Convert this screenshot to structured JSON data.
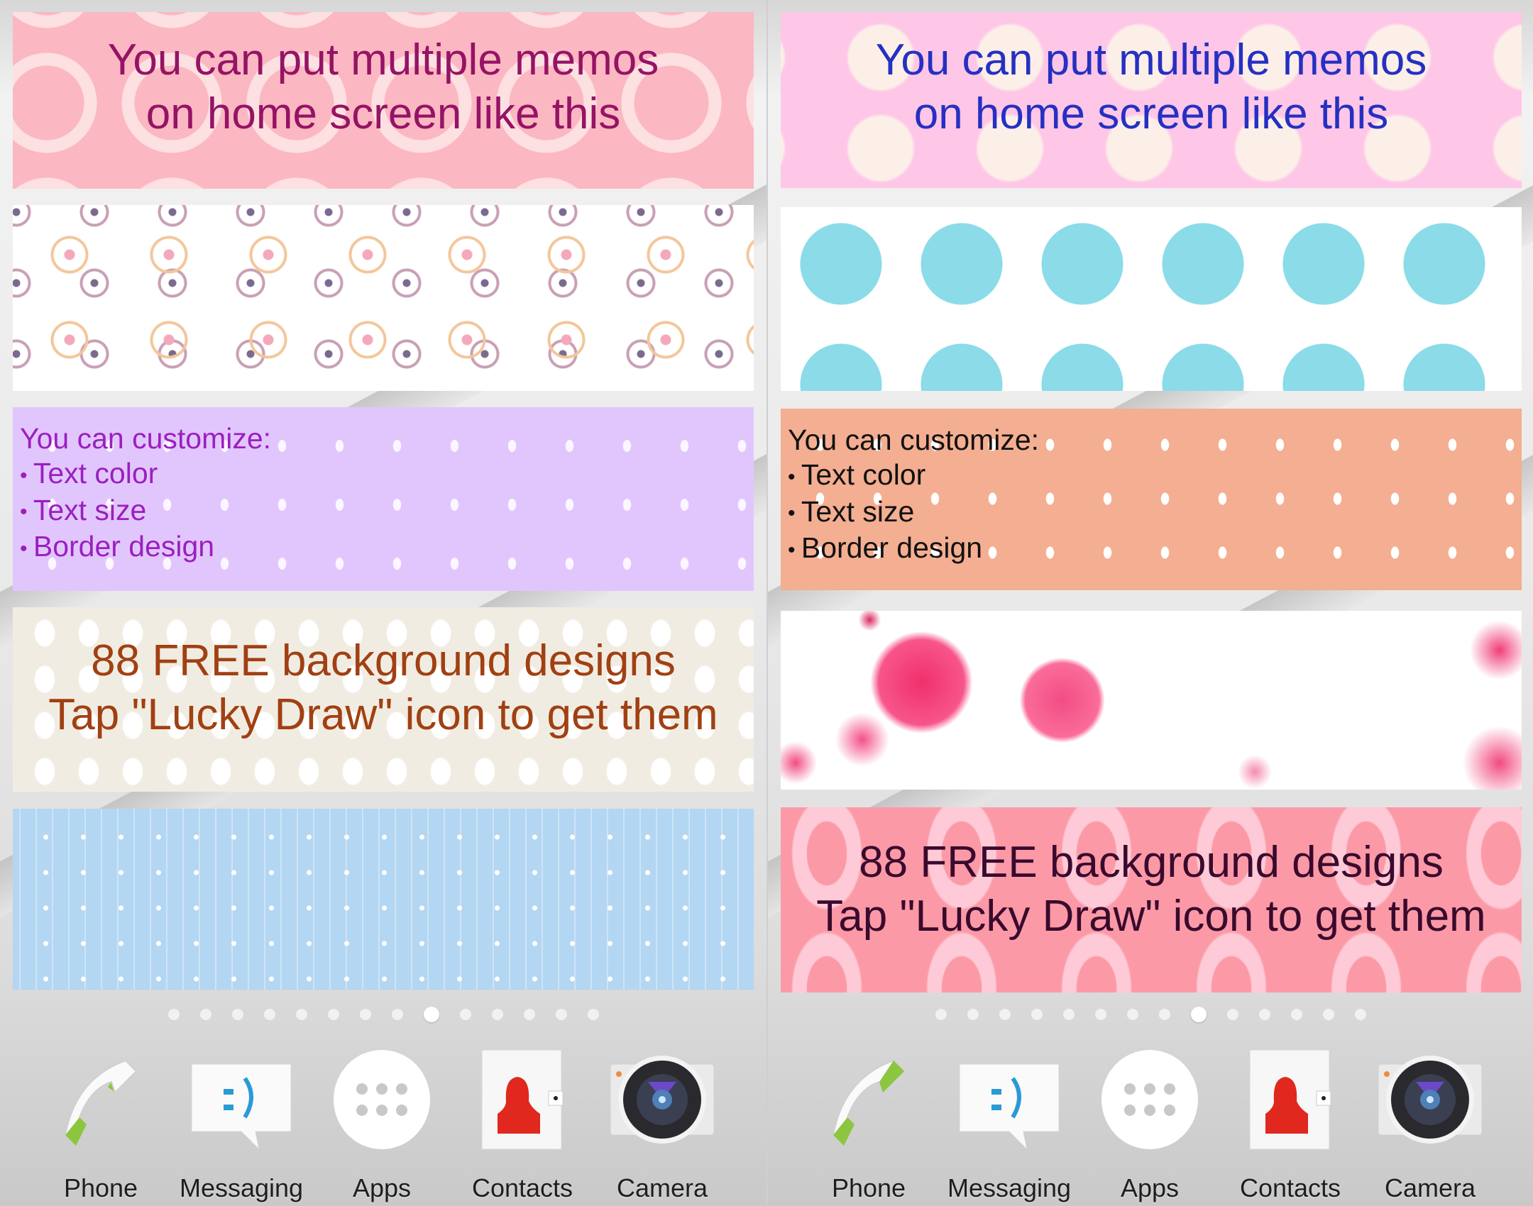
{
  "screens": [
    {
      "side": "left",
      "memos": [
        {
          "lines": [
            "You can put multiple memos",
            "on home screen like this"
          ],
          "text_color": "#951365",
          "style": "pink-rings"
        },
        {
          "lines": [],
          "style": "white-circles"
        },
        {
          "heading": "You can customize:",
          "items": [
            "Text color",
            "Text size",
            "Border design"
          ],
          "text_color": "#9b1fbf",
          "style": "lilac-dots"
        },
        {
          "lines": [
            "88 FREE background designs",
            "Tap \"Lucky Draw\" icon to get them"
          ],
          "text_color": "#a14012",
          "style": "cream-scallop"
        },
        {
          "lines": [],
          "style": "blue-flowers"
        }
      ],
      "pager": {
        "count": 14,
        "active_index": 8
      },
      "dock": [
        {
          "label": "Phone",
          "icon": "phone-icon"
        },
        {
          "label": "Messaging",
          "icon": "messaging-icon"
        },
        {
          "label": "Apps",
          "icon": "apps-icon"
        },
        {
          "label": "Contacts",
          "icon": "contacts-icon"
        },
        {
          "label": "Camera",
          "icon": "camera-icon"
        }
      ]
    },
    {
      "side": "right",
      "memos": [
        {
          "lines": [
            "You can put multiple memos",
            "on home screen like this"
          ],
          "text_color": "#2530c2",
          "style": "pink-fluff"
        },
        {
          "lines": [],
          "style": "cyan-rings"
        },
        {
          "heading": "You can customize:",
          "items": [
            "Text color",
            "Text size",
            "Border design"
          ],
          "text_color": "#111111",
          "style": "peach-dots"
        },
        {
          "lines": [],
          "style": "ink-splash"
        },
        {
          "lines": [
            "88 FREE background designs",
            "Tap \"Lucky Draw\" icon to get them"
          ],
          "text_color": "#3a0a2e",
          "style": "pink-donuts"
        }
      ],
      "pager": {
        "count": 14,
        "active_index": 8
      },
      "dock": [
        {
          "label": "Phone",
          "icon": "phone-icon"
        },
        {
          "label": "Messaging",
          "icon": "messaging-icon"
        },
        {
          "label": "Apps",
          "icon": "apps-icon"
        },
        {
          "label": "Contacts",
          "icon": "contacts-icon"
        },
        {
          "label": "Camera",
          "icon": "camera-icon"
        }
      ]
    }
  ]
}
